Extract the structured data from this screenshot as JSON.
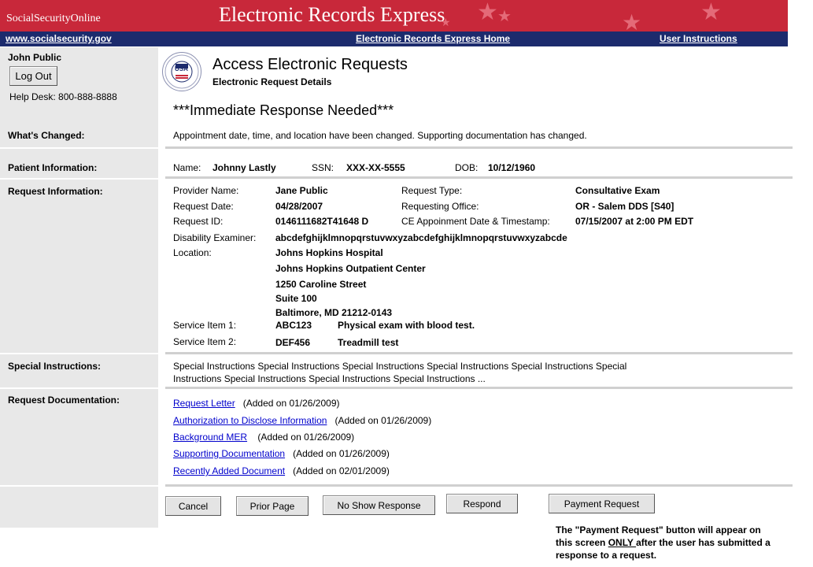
{
  "banner": {
    "ssa_label": "SocialSecurityOnline",
    "title": "Electronic Records Express"
  },
  "nav": {
    "site_link": "www.socialsecurity.gov",
    "home_link": "Electronic Records Express Home",
    "instructions_link": "User Instructions"
  },
  "user": {
    "name": "John Public",
    "logout_label": "Log Out",
    "helpdesk": "Help Desk: 800-888-8888"
  },
  "logo": {
    "top": "SOCIAL SECURITY",
    "usa": "USA",
    "bottom": "ADMINISTRATION"
  },
  "page": {
    "title": "Access Electronic Requests",
    "subtitle": "Electronic Request Details",
    "alert": "***Immediate Response Needed***"
  },
  "sections": {
    "whats_changed": "What's Changed:",
    "patient": "Patient Information:",
    "request": "Request Information:",
    "special": "Special Instructions:",
    "docs": "Request Documentation:"
  },
  "whats_changed_text": "Appointment date, time, and location have been changed.  Supporting documentation has changed.",
  "patient": {
    "name_label": "Name:",
    "name": "Johnny Lastly",
    "ssn_label": "SSN:",
    "ssn": "XXX-XX-5555",
    "dob_label": "DOB:",
    "dob": "10/12/1960"
  },
  "request": {
    "provider_label": "Provider Name:",
    "provider": "Jane Public",
    "type_label": "Request Type:",
    "type": "Consultative Exam",
    "date_label": "Request Date:",
    "date": "04/28/2007",
    "office_label": "Requesting Office:",
    "office": "OR - Salem DDS [S40]",
    "id_label": "Request ID:",
    "id": "0146111682T41648 D",
    "ce_label": "CE Appoinment Date & Timestamp:",
    "ce": "07/15/2007 at 2:00 PM EDT",
    "examiner_label": "Disability Examiner:",
    "examiner": "abcdefghijklmnopqrstuvwxyzabcdefghijklmnopqrstuvwxyzabcde",
    "location_label": "Location:",
    "location": [
      "Johns Hopkins Hospital",
      "Johns Hopkins Outpatient Center",
      "1250 Caroline Street",
      "Suite 100",
      "Baltimore, MD 21212-0143"
    ],
    "service1_label": "Service Item 1:",
    "service1_code": "ABC123",
    "service1_desc": "Physical exam with blood test.",
    "service2_label": "Service Item 2:",
    "service2_code": "DEF456",
    "service2_desc": "Treadmill test"
  },
  "special_text": [
    "Special Instructions Special Instructions  Special Instructions Special Instructions Special Instructions Special",
    "Instructions Special Instructions Special Instructions Special Instructions ..."
  ],
  "documents": [
    {
      "link": "Request Letter",
      "added": "(Added on 01/26/2009)"
    },
    {
      "link": "Authorization to Disclose Information",
      "added": "(Added on 01/26/2009)"
    },
    {
      "link": "Background MER",
      "added": "(Added on 01/26/2009)"
    },
    {
      "link": "Supporting Documentation",
      "added": "(Added on 01/26/2009)"
    },
    {
      "link": "Recently Added Document",
      "added": "(Added on 02/01/2009)"
    }
  ],
  "buttons": {
    "cancel": "Cancel",
    "prior": "Prior Page",
    "noshow": "No Show Response",
    "respond": "Respond",
    "payment": "Payment Request"
  },
  "payment_note": {
    "l1": "The \"Payment Request\" button will appear on",
    "l2_pre": "this screen ",
    "l2_only": "ONLY ",
    "l2_post": "after the user has submitted a",
    "l3": "response to a request."
  }
}
